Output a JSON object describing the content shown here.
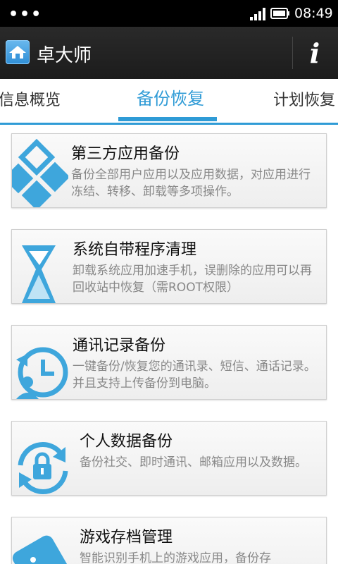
{
  "status_bar": {
    "time": "08:49",
    "dots": "•••"
  },
  "app_bar": {
    "title": "卓大师",
    "info_label": "i"
  },
  "tabs": [
    {
      "label": "信息概览"
    },
    {
      "label": "备份恢复"
    },
    {
      "label": "计划恢复"
    }
  ],
  "cards": [
    {
      "title": "第三方应用备份",
      "desc": "备份全部用户应用以及应用数据，对应用进行冻结、转移、卸载等多项操作。"
    },
    {
      "title": "系统自带程序清理",
      "desc": "卸载系统应用加速手机，误删除的应用可以再回收站中恢复（需ROOT权限）"
    },
    {
      "title": "通讯记录备份",
      "desc": "一键备份/恢复您的通讯录、短信、通话记录。并且支持上传备份到电脑。"
    },
    {
      "title": "个人数据备份",
      "desc": "备份社交、即时通讯、邮箱应用以及数据。"
    },
    {
      "title": "游戏存档管理",
      "desc": "智能识别手机上的游戏应用，备份存"
    }
  ],
  "colors": {
    "accent": "#2f9bd6",
    "icon_blue": "#3ea6dc",
    "statusbar": "#000000",
    "appbar": "#222222"
  }
}
